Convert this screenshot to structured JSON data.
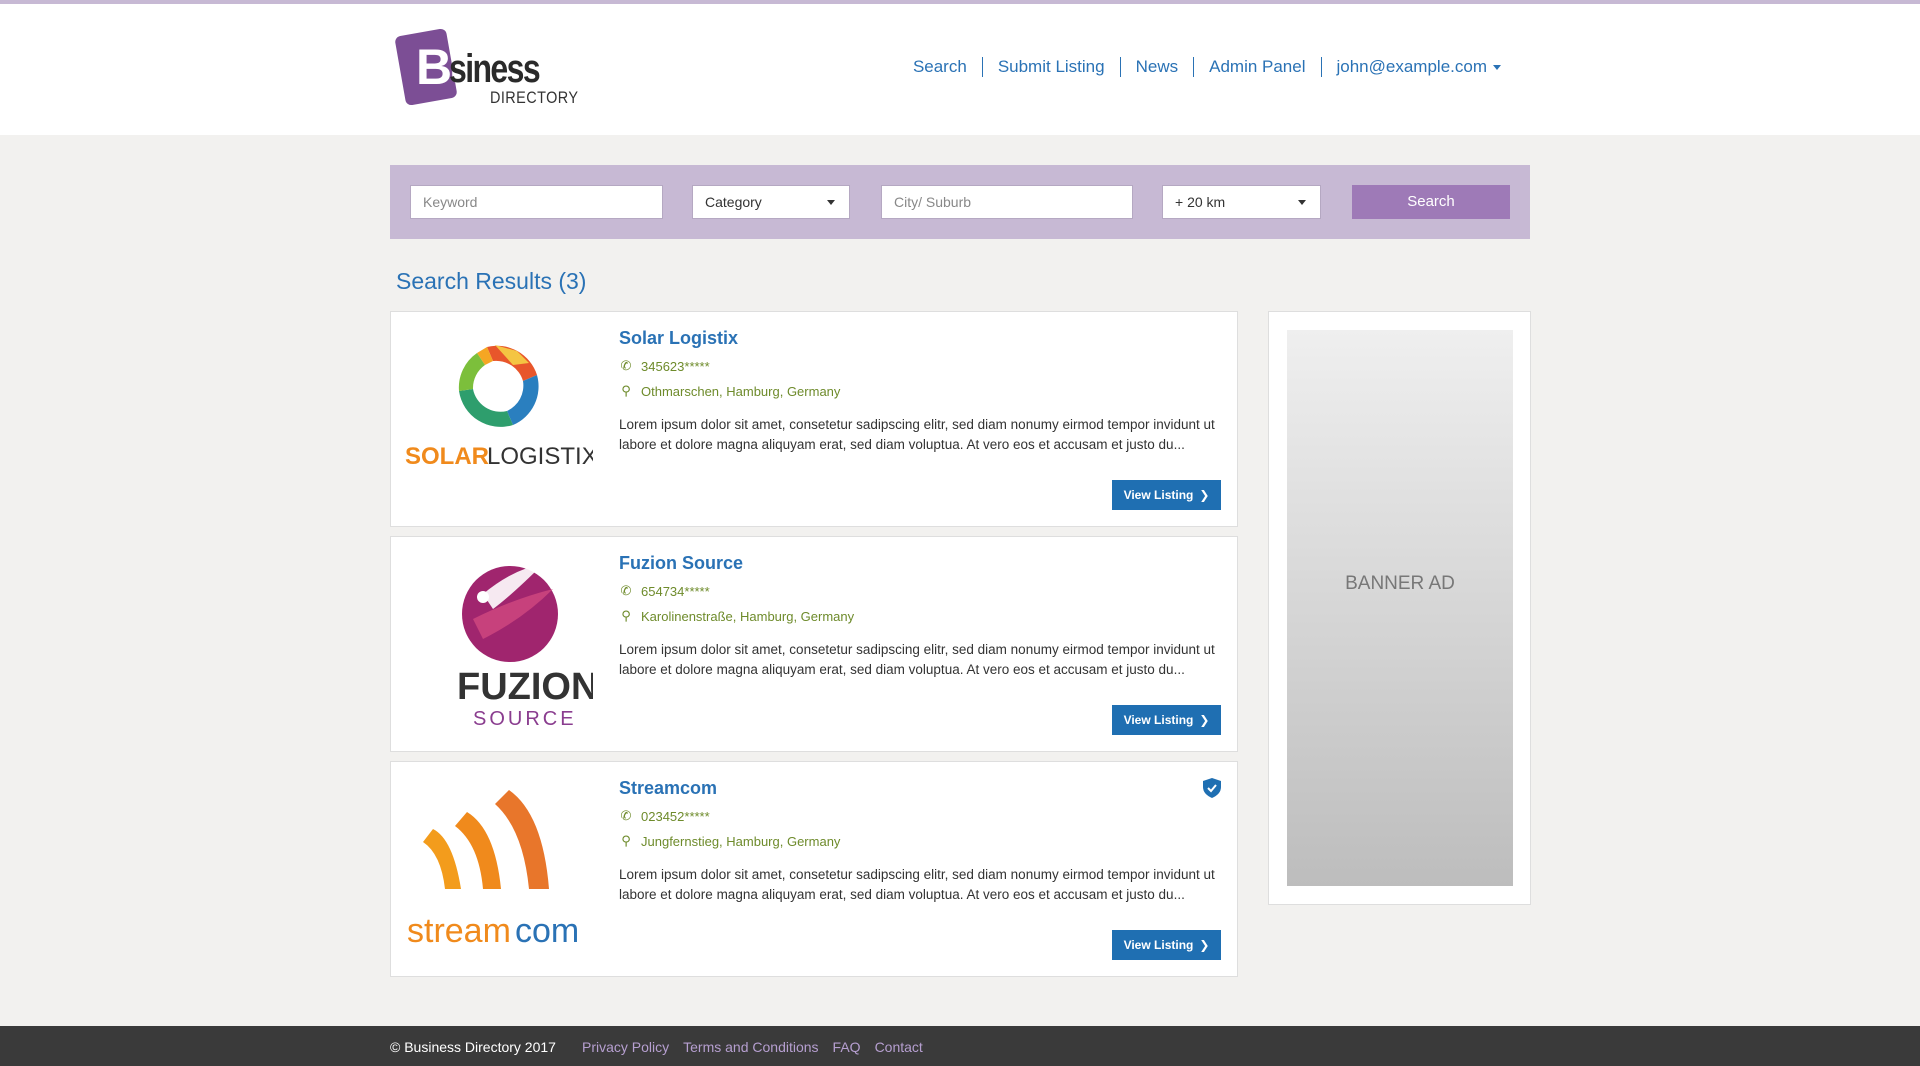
{
  "brand": {
    "logo_main": "Bu",
    "logo_rest": "siness",
    "logo_sub": "DIRECTORY",
    "accent": "#7c4e95"
  },
  "nav": {
    "items": [
      "Search",
      "Submit Listing",
      "News",
      "Admin Panel"
    ],
    "user": "john@example.com"
  },
  "search": {
    "keyword_placeholder": "Keyword",
    "category": "Category",
    "city_placeholder": "City/ Suburb",
    "distance": "+ 20 km",
    "button": "Search"
  },
  "results": {
    "title": "Search Results (3)",
    "view_label": "View Listing",
    "items": [
      {
        "name": "Solar Logistix",
        "phone": "345623*****",
        "address": "Othmarschen, Hamburg, Germany",
        "desc": "Lorem ipsum dolor sit amet, consetetur sadipscing elitr, sed diam nonumy eirmod tempor invidunt ut labore et dolore magna aliquyam erat, sed diam voluptua. At vero eos et accusam et justo du...",
        "logo_text_a": "SOLAR",
        "logo_text_b": "LOGISTIX",
        "verified": false
      },
      {
        "name": "Fuzion Source",
        "phone": "654734*****",
        "address": "Karolinenstraße, Hamburg, Germany",
        "desc": "Lorem ipsum dolor sit amet, consetetur sadipscing elitr, sed diam nonumy eirmod tempor invidunt ut labore et dolore magna aliquyam erat, sed diam voluptua. At vero eos et accusam et justo du...",
        "logo_text_a": "FUZION",
        "logo_text_b": "SOURCE",
        "verified": false
      },
      {
        "name": "Streamcom",
        "phone": "023452*****",
        "address": "Jungfernstieg, Hamburg, Germany",
        "desc": "Lorem ipsum dolor sit amet, consetetur sadipscing elitr, sed diam nonumy eirmod tempor invidunt ut labore et dolore magna aliquyam erat, sed diam voluptua. At vero eos et accusam et justo du...",
        "logo_text_a": "stream",
        "logo_text_b": "com",
        "verified": true
      }
    ]
  },
  "banner": {
    "text": "BANNER AD"
  },
  "footer": {
    "copyright": "© Business Directory 2017",
    "links": [
      "Privacy Policy",
      "Terms and Conditions",
      "FAQ",
      "Contact"
    ]
  },
  "icons": {
    "phone": "phone-icon",
    "location": "map-marker-icon",
    "verified": "shield-check-icon",
    "chevron": "chevron-right-icon"
  }
}
